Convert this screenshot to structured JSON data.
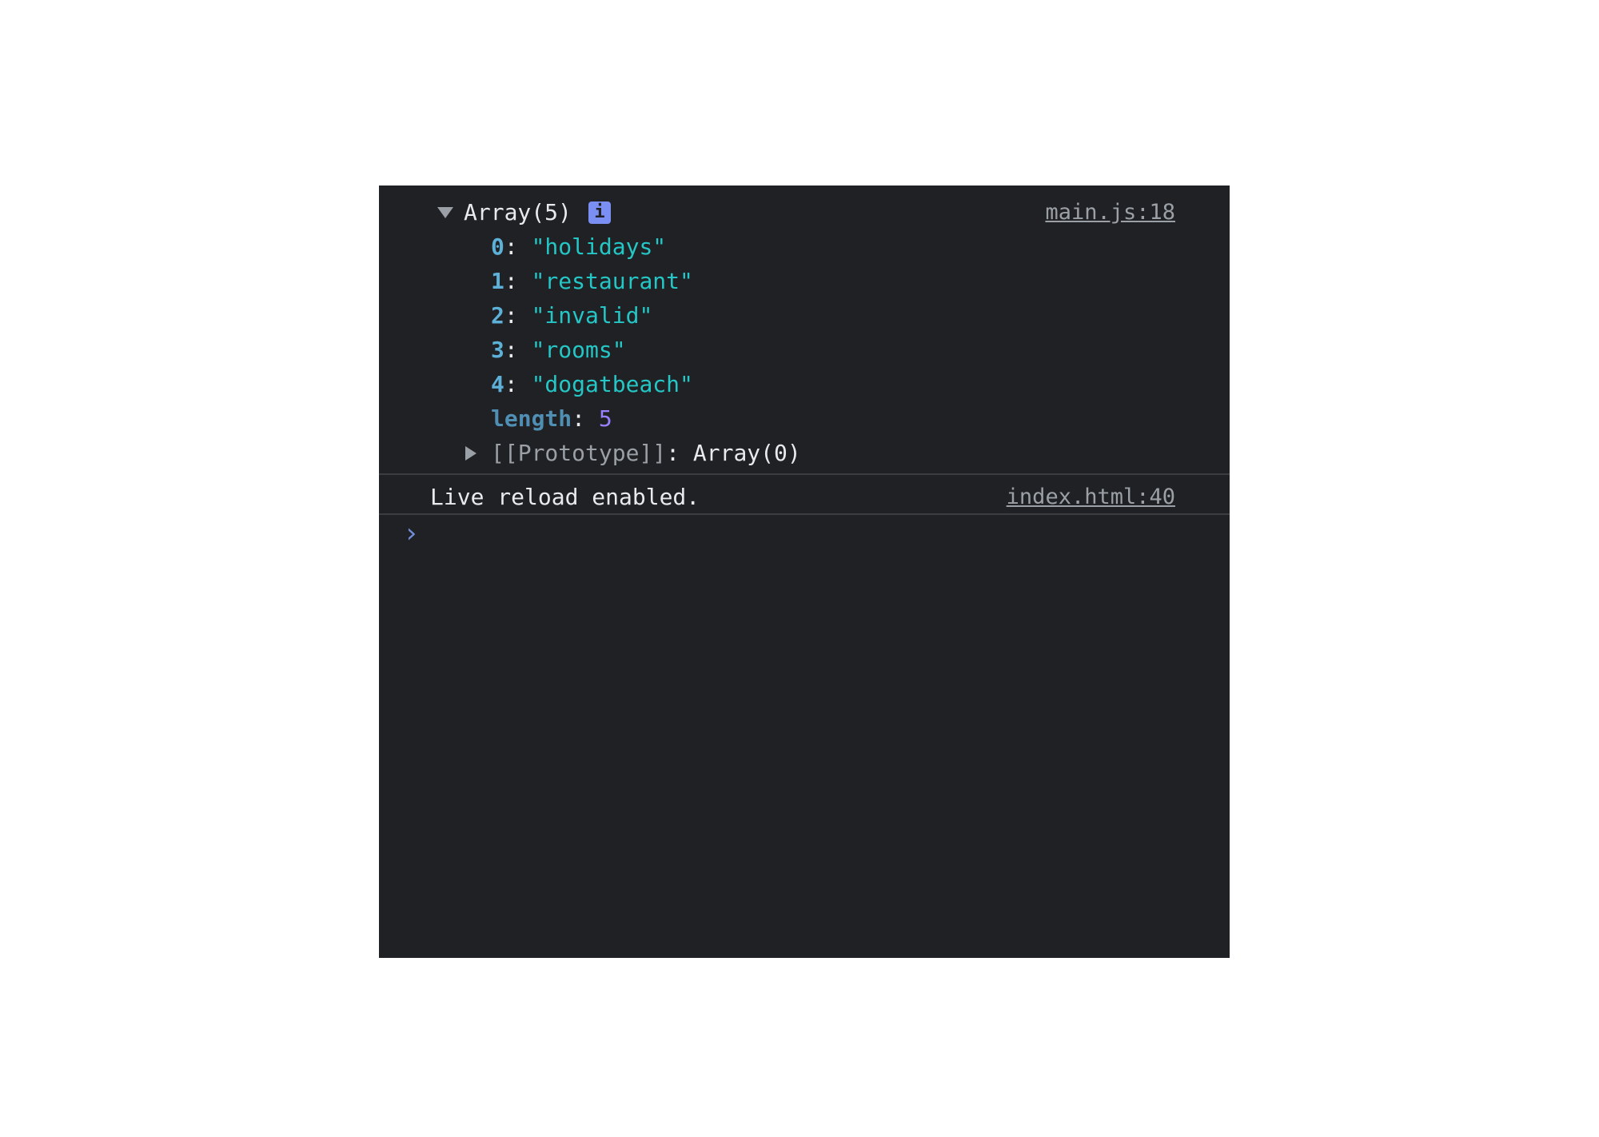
{
  "console": {
    "array_entry": {
      "summary": "Array(5)",
      "info_badge": "i",
      "source": "main.js:18",
      "items": [
        {
          "index": "0",
          "value": "\"holidays\""
        },
        {
          "index": "1",
          "value": "\"restaurant\""
        },
        {
          "index": "2",
          "value": "\"invalid\""
        },
        {
          "index": "3",
          "value": "\"rooms\""
        },
        {
          "index": "4",
          "value": "\"dogatbeach\""
        }
      ],
      "length_key": "length",
      "length_value": "5",
      "prototype_key": "[[Prototype]]",
      "prototype_value": "Array(0)"
    },
    "log_entry": {
      "message": "Live reload enabled.",
      "source": "index.html:40"
    },
    "prompt_symbol": "›"
  },
  "colors": {
    "background": "#202124",
    "index": "#5db0d7",
    "string": "#25c6c6",
    "number": "#9980ff",
    "info_badge": "#7b8ef2"
  }
}
